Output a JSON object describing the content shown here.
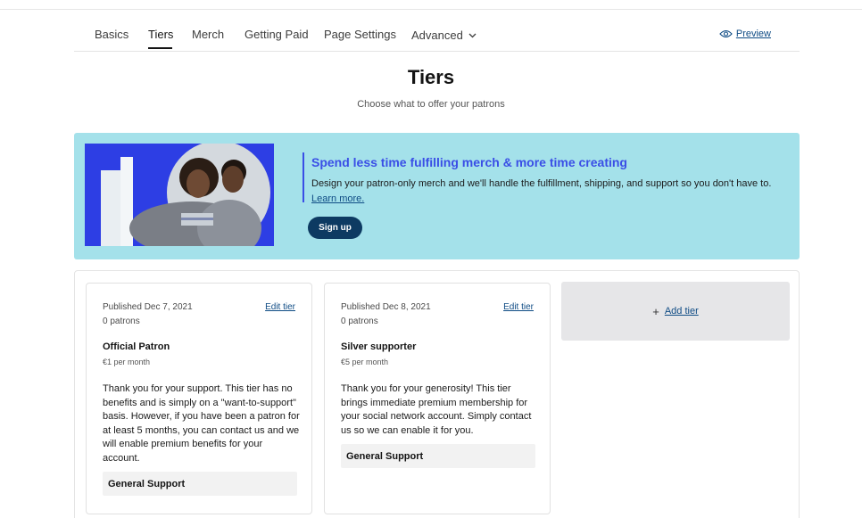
{
  "nav": {
    "items": [
      {
        "label": "Basics",
        "active": false
      },
      {
        "label": "Tiers",
        "active": true
      },
      {
        "label": "Merch",
        "active": false
      },
      {
        "label": "Getting Paid",
        "active": false
      },
      {
        "label": "Page Settings",
        "active": false
      },
      {
        "label": "Advanced",
        "active": false
      }
    ],
    "preview_label": "Preview",
    "preview_icon": "eye-icon",
    "advanced_icon": "chevron-down-icon"
  },
  "header": {
    "title": "Tiers",
    "subtitle": "Choose what to offer your patrons"
  },
  "banner": {
    "headline": "Spend less time fulfilling merch & more time creating",
    "text": "Design your patron-only merch and we'll handle the fulfillment, shipping, and support so you don't have to.",
    "link_label": "Learn more.",
    "button_label": "Sign up",
    "accent_color": "#3a4ee6",
    "background_color": "#a4e1ea"
  },
  "tiers": [
    {
      "published": "Published Dec 7, 2021",
      "edit_label": "Edit tier",
      "patrons": "0 patrons",
      "name": "Official Patron",
      "price": "€1 per month",
      "description": "Thank you for your support. This tier has no benefits and is simply on a \"want-to-support\" basis. However, if you have been a patron for at least 5 months, you can contact us and we will enable premium benefits for your account.",
      "benefit": "General Support"
    },
    {
      "published": "Published Dec 8, 2021",
      "edit_label": "Edit tier",
      "patrons": "0 patrons",
      "name": "Silver supporter",
      "price": "€5 per month",
      "description": "Thank you for your generosity! This tier brings immediate premium membership for your social network account. Simply contact us so we can enable it for you.",
      "benefit": "General Support"
    }
  ],
  "add_tier": {
    "icon": "plus-icon",
    "label": "Add tier"
  }
}
